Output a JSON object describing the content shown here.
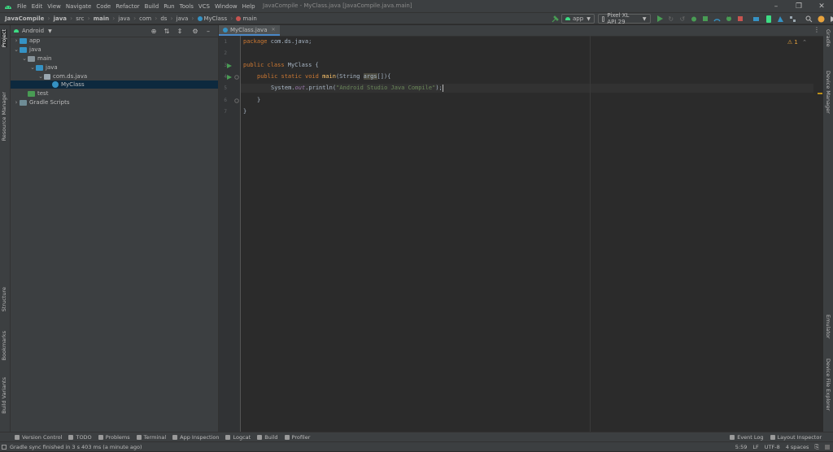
{
  "menu": {
    "items": [
      "File",
      "Edit",
      "View",
      "Navigate",
      "Code",
      "Refactor",
      "Build",
      "Run",
      "Tools",
      "VCS",
      "Window",
      "Help"
    ],
    "window_title": "JavaCompile - MyClass.java [JavaCompile.java.main]"
  },
  "breadcrumbs": [
    "JavaCompile",
    "java",
    "src",
    "main",
    "java",
    "com",
    "ds",
    "java",
    "MyClass",
    "main"
  ],
  "run": {
    "config": "app",
    "device": "Pixel XL API 29"
  },
  "left_stripe": [
    "Project",
    "Resource Manager",
    "Structure",
    "Bookmarks",
    "Build Variants"
  ],
  "right_stripe": [
    "Gradle",
    "Device Manager",
    "Emulator",
    "Device File Explorer"
  ],
  "project": {
    "view": "Android",
    "tree": [
      {
        "label": "app",
        "depth": 0,
        "expanded": false,
        "kind": "module",
        "selected": false
      },
      {
        "label": "java",
        "depth": 0,
        "expanded": true,
        "kind": "module",
        "selected": false
      },
      {
        "label": "main",
        "depth": 1,
        "expanded": true,
        "kind": "folder",
        "selected": false
      },
      {
        "label": "java",
        "depth": 2,
        "expanded": true,
        "kind": "src",
        "selected": false
      },
      {
        "label": "com.ds.java",
        "depth": 3,
        "expanded": true,
        "kind": "package",
        "selected": false
      },
      {
        "label": "MyClass",
        "depth": 4,
        "expanded": null,
        "kind": "class",
        "selected": true
      },
      {
        "label": "test",
        "depth": 1,
        "expanded": null,
        "kind": "folder",
        "selected": false
      },
      {
        "label": "Gradle Scripts",
        "depth": 0,
        "expanded": false,
        "kind": "gradle",
        "selected": false
      }
    ]
  },
  "editor": {
    "tab": "MyClass.java",
    "line_numbers": [
      "1",
      "2",
      "3",
      "4",
      "5",
      "6",
      "7"
    ],
    "code": {
      "l1_kw": "package",
      "l1_rest": " com.ds.java;",
      "l3_kw": "public class",
      "l3_rest": " MyClass {",
      "l4_kw": "public static void",
      "l4_fn": "main",
      "l4_a": "(String ",
      "l4_param": "args",
      "l4_b": "[]){",
      "l5_a": "System.",
      "l5_field": "out",
      "l5_b": ".println(",
      "l5_str": "\"Android Studio Java Compile\"",
      "l5_c": ");",
      "l6": "}",
      "l7": "}"
    },
    "inspection": "1"
  },
  "bottom_tools": [
    "Version Control",
    "TODO",
    "Problems",
    "Terminal",
    "App Inspection",
    "Logcat",
    "Build",
    "Profiler"
  ],
  "bottom_right_tools": [
    "Event Log",
    "Layout Inspector"
  ],
  "status": {
    "message": "Gradle sync finished in 3 s 403 ms (a minute ago)",
    "position": "5:59",
    "line_sep": "LF",
    "encoding": "UTF-8",
    "indent": "4 spaces"
  },
  "colors": {
    "accent": "#4a88c7",
    "keyword": "#cc7832",
    "function": "#ffc66d",
    "string": "#6a8759",
    "run_green": "#499c54"
  }
}
